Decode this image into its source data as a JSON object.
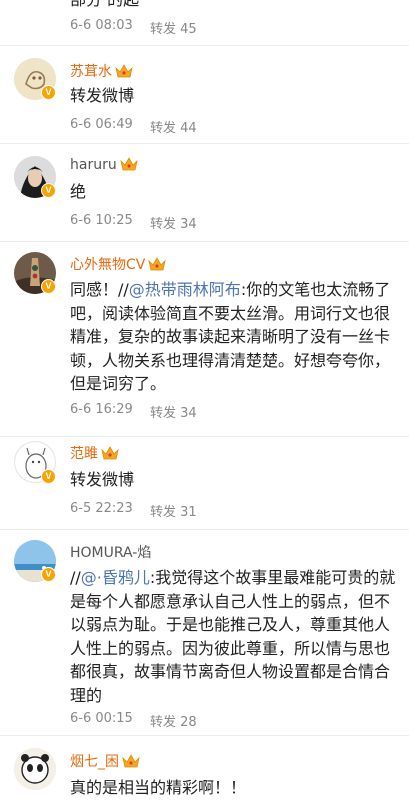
{
  "items": [
    {
      "name": "",
      "text_cut": "部分 的起",
      "time": "6-6 08:03",
      "repost_label": "转发 45"
    },
    {
      "name": "苏茸水",
      "text": "转发微博",
      "time": "6-6 06:49",
      "repost_label": "转发 44"
    },
    {
      "name": "haruru",
      "text": "绝",
      "time": "6-6 10:25",
      "repost_label": "转发 34"
    },
    {
      "name": "心外無物CV",
      "text_prefix": "同感！//",
      "mention": "@热带雨林阿布",
      "text_body": ":你的文笔也太流畅了吧，阅读体验简直不要太丝滑。用词行文也很精准，复杂的故事读起来清晰明了没有一丝卡顿，人物关系也理得清清楚楚。好想夸夸你，但是词穷了。",
      "time": "6-6 16:29",
      "repost_label": "转发 34"
    },
    {
      "name": "范雎",
      "text": "转发微博",
      "time": "6-5 22:23",
      "repost_label": "转发 31"
    },
    {
      "name": "HOMURA-焰",
      "text_prefix": "//",
      "mention": "@·昏鸦儿",
      "text_body": ":我觉得这个故事里最难能可贵的就是每个人都愿意承认自己人性上的弱点，但不以弱点为耻。于是也能推己及人，尊重其他人人性上的弱点。因为彼此尊重，所以情与思也都很真，故事情节离奇但人物设置都是合情合理的",
      "time": "6-6 00:15",
      "repost_label": "转发 28"
    },
    {
      "name": "烟七_困",
      "text": "真的是相当的精彩啊！！",
      "time": "",
      "repost_label": ""
    }
  ],
  "badge_letter": "V",
  "colors": {
    "name": "#e86b12",
    "link": "#4c76b2",
    "meta": "#888888"
  },
  "icons": [
    "crown-icon",
    "verified-badge-icon"
  ]
}
